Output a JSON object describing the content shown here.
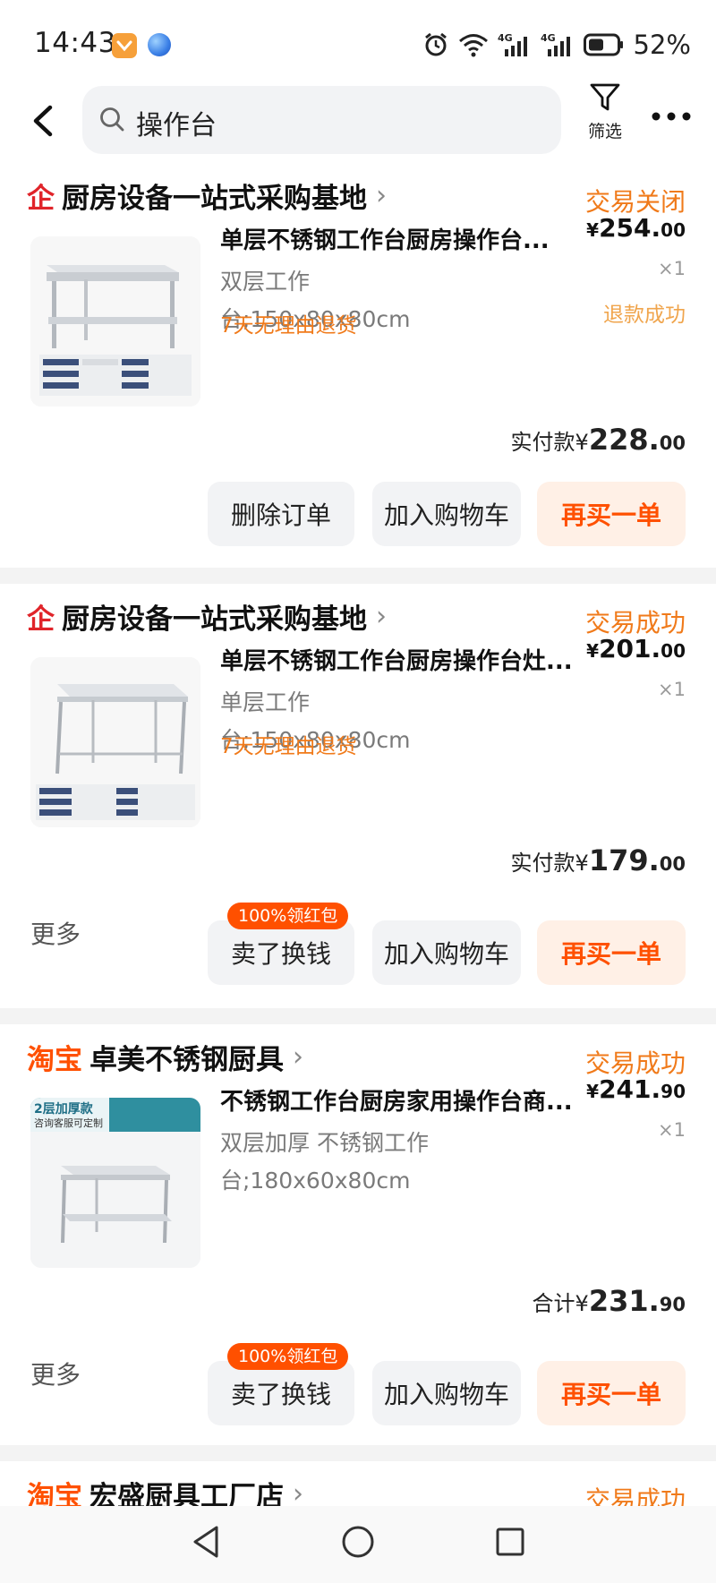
{
  "status_bar": {
    "time": "14:43",
    "battery": "52%",
    "network": "4G"
  },
  "header": {
    "query": "操作台",
    "filter_label": "筛选"
  },
  "orders": [
    {
      "brand": "企",
      "brand_type": "tmall",
      "shop": "厨房设备一站式采购基地",
      "status": "交易关闭",
      "title": "单层不锈钢工作台厨房操作台...",
      "spec": "双层工作台;150x80x80cm",
      "policy": "7天无理由退货",
      "price_int": "254.",
      "price_dec": "00",
      "currency": "¥",
      "qty": "×1",
      "refund": "退款成功",
      "paid_label": "实付款",
      "paid_int": "228.",
      "paid_dec": "00",
      "buttons": [
        "删除订单",
        "加入购物车",
        "再买一单"
      ]
    },
    {
      "brand": "企",
      "brand_type": "tmall",
      "shop": "厨房设备一站式采购基地",
      "status": "交易成功",
      "title": "单层不锈钢工作台厨房操作台灶...",
      "spec": "单层工作台;150x80x80cm",
      "policy": "7天无理由退货",
      "price_int": "201.",
      "price_dec": "00",
      "currency": "¥",
      "qty": "×1",
      "paid_label": "实付款",
      "paid_int": "179.",
      "paid_dec": "00",
      "more": "更多",
      "badge": "100%领红包",
      "buttons": [
        "卖了换钱",
        "加入购物车",
        "再买一单"
      ]
    },
    {
      "brand": "淘宝",
      "brand_type": "taobao",
      "shop": "卓美不锈钢厨具",
      "status": "交易成功",
      "title": "不锈钢工作台厨房家用操作台商...",
      "spec": "双层加厚 不锈钢工作台;180x60x80cm",
      "price_int": "241.",
      "price_dec": "90",
      "currency": "¥",
      "qty": "×1",
      "thumb_text_1": "2层加厚款",
      "thumb_text_2": "咨询客服可定制",
      "paid_label": "合计",
      "paid_int": "231.",
      "paid_dec": "90",
      "more": "更多",
      "badge": "100%领红包",
      "buttons": [
        "卖了换钱",
        "加入购物车",
        "再买一单"
      ]
    },
    {
      "brand": "淘宝",
      "brand_type": "taobao",
      "shop": "宏盛厨具工厂店",
      "status": "交易成功"
    }
  ],
  "colors": {
    "accent": "#ff5000",
    "status_orange": "#f07a1a",
    "tmall_red": "#e0242a"
  }
}
